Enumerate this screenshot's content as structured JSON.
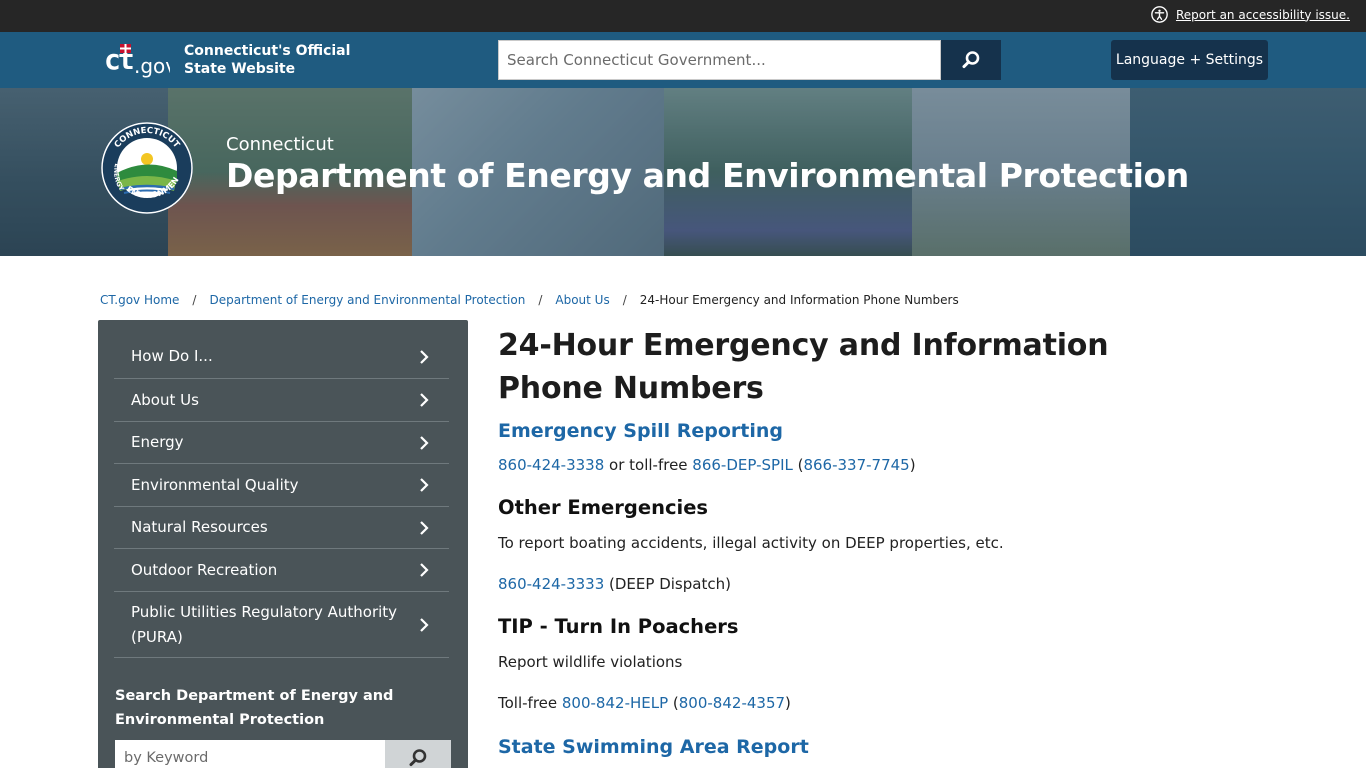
{
  "utility": {
    "accessibility_link": "Report an accessibility issue."
  },
  "header": {
    "logo_text": "ct.gov",
    "site_name_line1": "Connecticut's Official",
    "site_name_line2": "State Website",
    "search_placeholder": "Search Connecticut Government...",
    "language_button": "Language + Settings"
  },
  "hero": {
    "subtitle": "Connecticut",
    "title": "Department of Energy and Environmental Protection",
    "seal_text_top": "CONNECTICUT",
    "seal_text_left": "ENERGY",
    "seal_text_bottom": "ENVIRONMENT"
  },
  "breadcrumb": {
    "items": [
      "CT.gov Home",
      "Department of Energy and Environmental Protection",
      "About Us"
    ],
    "separator": "/",
    "current": "24-Hour Emergency and Information Phone Numbers"
  },
  "sidenav": {
    "items": [
      {
        "label": "How Do I..."
      },
      {
        "label": "About Us"
      },
      {
        "label": "Energy"
      },
      {
        "label": "Environmental Quality"
      },
      {
        "label": "Natural Resources"
      },
      {
        "label": "Outdoor Recreation"
      },
      {
        "label": "Public Utilities Regulatory Authority (PURA)"
      }
    ],
    "search_title": "Search Department of Energy and Environmental Protection",
    "search_placeholder": "by Keyword"
  },
  "main": {
    "title": "24-Hour Emergency and Information Phone Numbers",
    "spill": {
      "heading": "Emergency Spill Reporting",
      "phone1": "860-424-3338",
      "text1": " or toll-free ",
      "phone2": "866-DEP-SPIL",
      "text2": " (",
      "phone3": "866-337-7745",
      "text3": ")"
    },
    "other": {
      "heading": "Other Emergencies",
      "desc": "To report boating accidents, illegal activity on DEEP properties, etc.",
      "phone": "860-424-3333",
      "phone_note": " (DEEP Dispatch)"
    },
    "tip": {
      "heading": "TIP - Turn In Poachers",
      "desc": "Report wildlife violations",
      "prefix": "Toll-free ",
      "phone1": "800-842-HELP",
      "text1": " (",
      "phone2": "800-842-4357",
      "text2": ")"
    },
    "swim": {
      "heading": "State Swimming Area Report"
    }
  },
  "colors": {
    "utility_bar": "#262626",
    "header_blue": "#1f5b80",
    "dark_button": "#15324c",
    "link_blue": "#1d67a6",
    "sidenav_bg": "#4a5458"
  }
}
